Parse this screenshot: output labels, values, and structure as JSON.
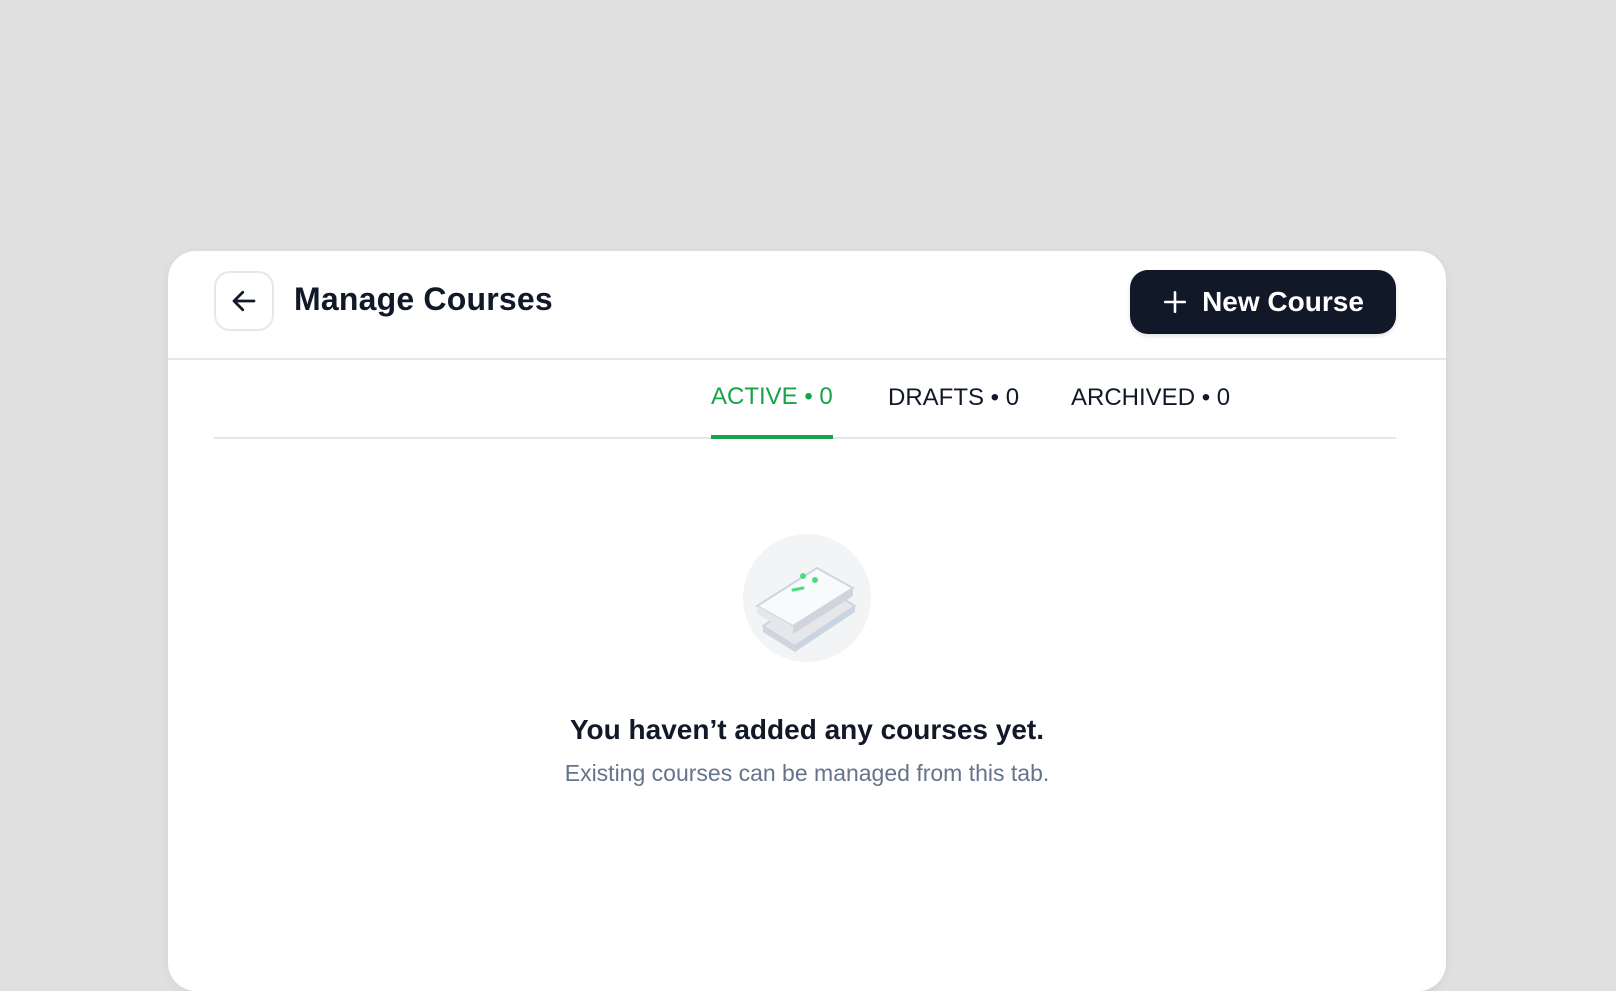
{
  "header": {
    "back_icon": "arrow-left-icon",
    "title": "Manage Courses",
    "new_course_label": "New Course",
    "new_course_icon": "plus-icon"
  },
  "tabs": [
    {
      "label": "ACTIVE • 0",
      "active": true
    },
    {
      "label": "DRAFTS • 0",
      "active": false
    },
    {
      "label": "ARCHIVED • 0",
      "active": false
    }
  ],
  "empty_state": {
    "icon": "books-icon",
    "title": "You haven’t added any courses yet.",
    "subtitle": "Existing courses can be managed from this tab."
  },
  "colors": {
    "accent": "#16a34a",
    "primary_button": "#111827",
    "background": "#e0e0e0",
    "muted_text": "#64748b"
  }
}
